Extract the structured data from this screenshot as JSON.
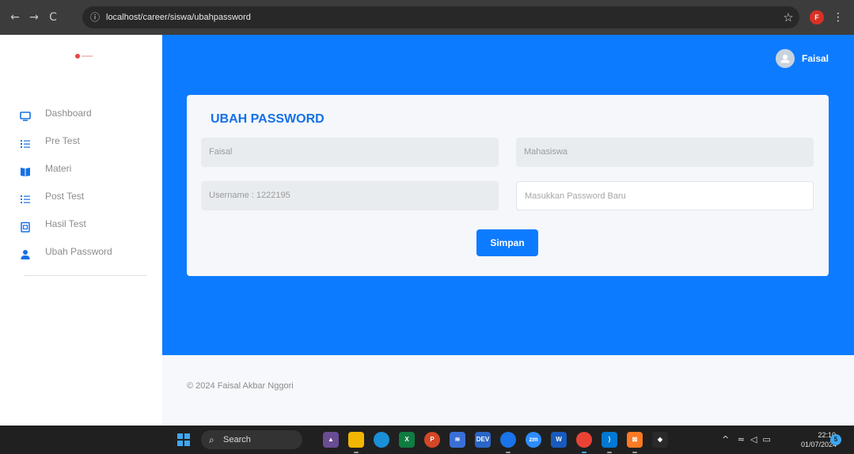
{
  "browser": {
    "url": "localhost/career/siswa/ubahpassword",
    "profile_initial": "F",
    "nav_icons": [
      "back-arrow-icon",
      "forward-arrow-icon",
      "reload-icon"
    ]
  },
  "header": {
    "user_name": "Faisal"
  },
  "sidebar": {
    "items": [
      {
        "label": "Dashboard",
        "icon": "monitor-icon"
      },
      {
        "label": "Pre Test",
        "icon": "list-icon"
      },
      {
        "label": "Materi",
        "icon": "book-icon"
      },
      {
        "label": "Post Test",
        "icon": "list-icon"
      },
      {
        "label": "Hasil Test",
        "icon": "clipboard-icon"
      },
      {
        "label": "Ubah Password",
        "icon": "user-icon"
      }
    ]
  },
  "form": {
    "title": "UBAH PASSWORD",
    "name_value": "Faisal",
    "role_value": "Mahasiswa",
    "username_value": "Username : 1222195",
    "password_placeholder": "Masukkan Password Baru",
    "save_label": "Simpan"
  },
  "footer": {
    "text": "© 2024 Faisal Akbar Nggori"
  },
  "taskbar": {
    "search_label": "Search",
    "time": "22:10",
    "date": "01/07/2024",
    "notification_count": "5"
  },
  "colors": {
    "primary": "#0d7bff",
    "title": "#1470e8"
  }
}
